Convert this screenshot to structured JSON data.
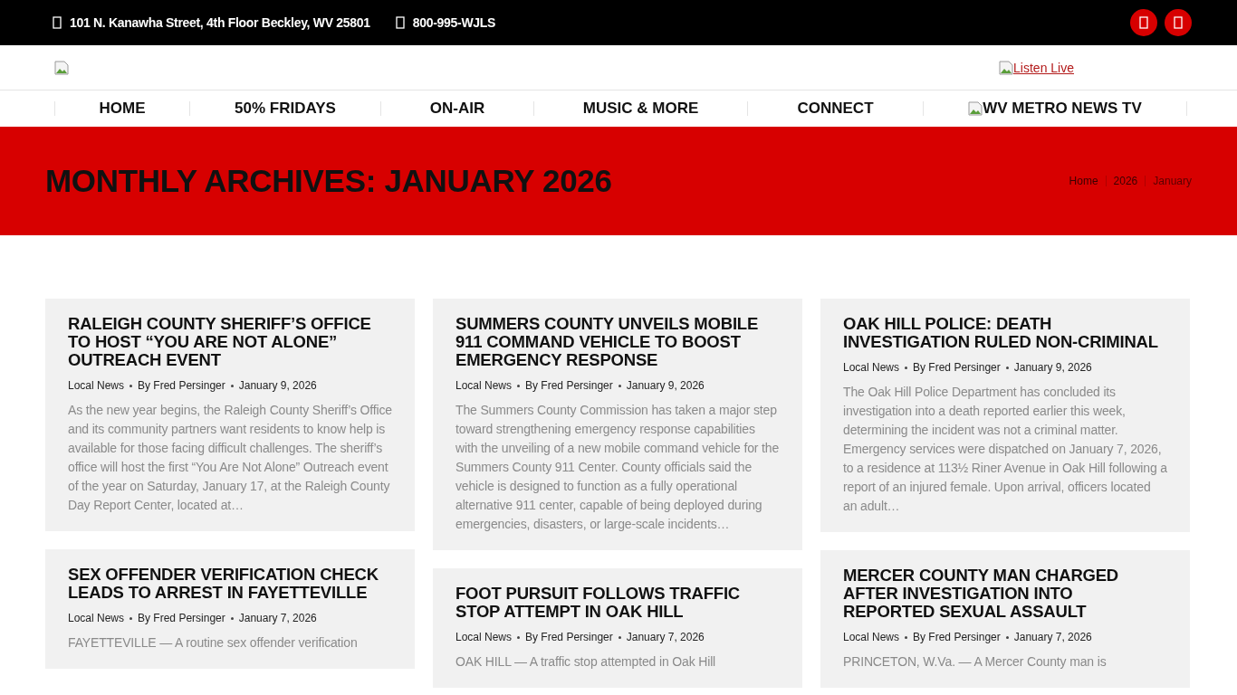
{
  "top_bar": {
    "address": "101 N. Kanawha Street, 4th Floor Beckley, WV 25801",
    "phone": "800-995-WJLS"
  },
  "header": {
    "listen_live": "Listen Live"
  },
  "nav": [
    {
      "label": "HOME",
      "kind": "text"
    },
    {
      "label": "50% FRIDAYS",
      "kind": "text"
    },
    {
      "label": "ON-AIR",
      "kind": "text"
    },
    {
      "label": "MUSIC & MORE",
      "kind": "text"
    },
    {
      "label": "CONNECT",
      "kind": "text"
    },
    {
      "label": "WV METRO NEWS TV",
      "kind": "image"
    }
  ],
  "page_title": "MONTHLY ARCHIVES: JANUARY 2026",
  "breadcrumbs": [
    "Home",
    "2026",
    "January"
  ],
  "columns": [
    [
      {
        "title": "RALEIGH COUNTY SHERIFF’S OFFICE TO HOST “YOU ARE NOT ALONE” OUTREACH EVENT",
        "category": "Local News",
        "author": "By Fred Persinger",
        "date": "January 9, 2026",
        "excerpt": "As the new year begins, the Raleigh County Sheriff’s Office and its community partners want residents to know help is available for those facing difficult challenges. The sheriff’s office will host the first “You Are Not Alone” Outreach event of the year on Saturday, January 17, at the Raleigh County Day Report Center, located at…"
      },
      {
        "title": "SEX OFFENDER VERIFICATION CHECK LEADS TO ARREST IN FAYETTEVILLE",
        "category": "Local News",
        "author": "By Fred Persinger",
        "date": "January 7, 2026",
        "excerpt": "FAYETTEVILLE — A routine sex offender verification"
      }
    ],
    [
      {
        "title": "SUMMERS COUNTY UNVEILS MOBILE 911 COMMAND VEHICLE TO BOOST EMERGENCY RESPONSE",
        "category": "Local News",
        "author": "By Fred Persinger",
        "date": "January 9, 2026",
        "excerpt": "The Summers County Commission has taken a major step toward strengthening emergency response capabilities with the unveiling of a new mobile command vehicle for the Summers County 911 Center. County officials said the vehicle is designed to function as a fully operational alternative 911 center, capable of being deployed during emergencies, disasters, or large-scale incidents…"
      },
      {
        "title": "FOOT PURSUIT FOLLOWS TRAFFIC STOP ATTEMPT IN OAK HILL",
        "category": "Local News",
        "author": "By Fred Persinger",
        "date": "January 7, 2026",
        "excerpt": "OAK HILL — A traffic stop attempted in Oak Hill"
      }
    ],
    [
      {
        "title": "OAK HILL POLICE: DEATH INVESTIGATION RULED NON-CRIMINAL",
        "category": "Local News",
        "author": "By Fred Persinger",
        "date": "January 9, 2026",
        "excerpt": "The Oak Hill Police Department has concluded its investigation into a death reported earlier this week, determining the incident was not a criminal matter. Emergency services were dispatched on January 7, 2026, to a residence at 113½ Riner Avenue in Oak Hill following a report of an injured female. Upon arrival, officers located an adult…"
      },
      {
        "title": "MERCER COUNTY MAN CHARGED AFTER INVESTIGATION INTO REPORTED SEXUAL ASSAULT",
        "category": "Local News",
        "author": "By Fred Persinger",
        "date": "January 7, 2026",
        "excerpt": "PRINCETON, W.Va. — A Mercer County man is"
      }
    ]
  ]
}
